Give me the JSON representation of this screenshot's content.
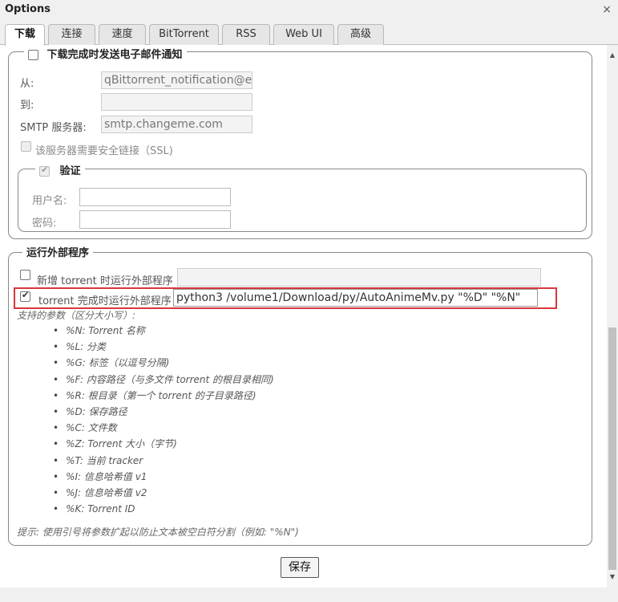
{
  "window": {
    "title": "Options",
    "close_glyph": "×"
  },
  "tabs": [
    {
      "label": "下载",
      "active": true
    },
    {
      "label": "连接"
    },
    {
      "label": "速度"
    },
    {
      "label": "BitTorrent"
    },
    {
      "label": "RSS"
    },
    {
      "label": "Web UI"
    },
    {
      "label": "高级"
    }
  ],
  "email": {
    "legend": "下载完成时发送电子邮件通知",
    "checked": false,
    "from_label": "从:",
    "from_value": "qBittorrent_notification@exa",
    "to_label": "到:",
    "to_value": "",
    "smtp_label": "SMTP 服务器:",
    "smtp_value": "smtp.changeme.com",
    "ssl_label": "该服务器需要安全链接（SSL)",
    "ssl_checked": false,
    "auth": {
      "legend": "验证",
      "checked": true,
      "username_label": "用户名:",
      "username_value": "",
      "password_label": "密码:",
      "password_value": ""
    }
  },
  "external": {
    "legend": "运行外部程序",
    "on_add_label": "新增 torrent 时运行外部程序",
    "on_add_checked": false,
    "on_add_value": "",
    "on_finish_label": "torrent 完成时运行外部程序",
    "on_finish_checked": true,
    "on_finish_value": "python3 /volume1/Download/py/AutoAnimeMv.py \"%D\" \"%N\"",
    "params_title": "支持的参数（区分大小写）:",
    "params": [
      "%N: Torrent 名称",
      "%L: 分类",
      "%G: 标签（以逗号分隔)",
      "%F: 内容路径（与多文件 torrent 的根目录相同)",
      "%R: 根目录（第一个 torrent 的子目录路径)",
      "%D: 保存路径",
      "%C: 文件数",
      "%Z: Torrent 大小（字节)",
      "%T: 当前 tracker",
      "%I: 信息哈希值 v1",
      "%J: 信息哈希值 v2",
      "%K: Torrent ID"
    ],
    "hint": "提示: 使用引号将参数扩起以防止文本被空白符分割（例如: \"%N\")"
  },
  "footer": {
    "save_label": "保存"
  },
  "colors": {
    "highlight": "#d9363e",
    "tab_active": "#ffffff",
    "tab_inactive": "#e6e6e6"
  },
  "icons": {
    "close": "close-icon",
    "scroll_up": "chevron-up-icon",
    "scroll_down": "chevron-down-icon",
    "check": "checkmark-icon"
  }
}
